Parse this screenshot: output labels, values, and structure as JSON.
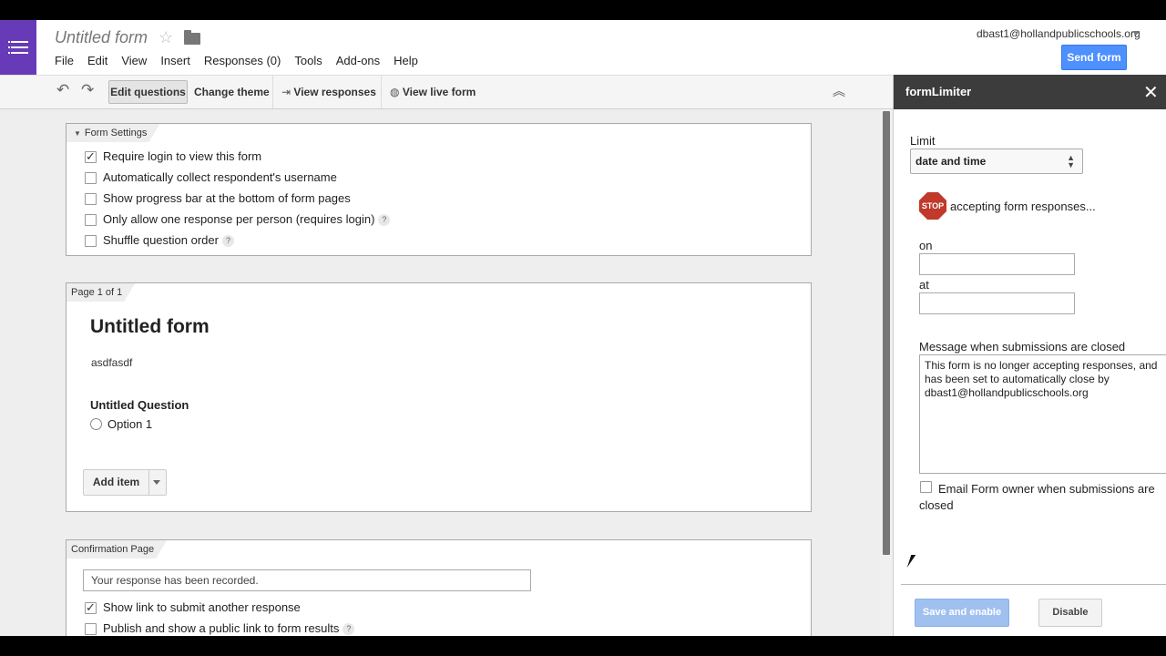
{
  "header": {
    "doc_title": "Untitled form",
    "menu": [
      "File",
      "Edit",
      "View",
      "Insert",
      "Responses (0)",
      "Tools",
      "Add-ons",
      "Help"
    ],
    "user_email": "dbast1@hollandpublicschools.org",
    "send_form_label": "Send form"
  },
  "toolbar": {
    "edit_questions": "Edit questions",
    "change_theme": "Change theme",
    "view_responses": "View responses",
    "view_live_form": "View live form"
  },
  "form_settings": {
    "tab": "Form Settings",
    "options": [
      {
        "label": "Require login to view this form",
        "checked": true,
        "help": false
      },
      {
        "label": "Automatically collect respondent's username",
        "checked": false,
        "help": false
      },
      {
        "label": "Show progress bar at the bottom of form pages",
        "checked": false,
        "help": false
      },
      {
        "label": "Only allow one response per person (requires login)",
        "checked": false,
        "help": true
      },
      {
        "label": "Shuffle question order",
        "checked": false,
        "help": true
      }
    ]
  },
  "page": {
    "tab": "Page 1 of 1",
    "title": "Untitled form",
    "description": "asdfasdf",
    "question_title": "Untitled Question",
    "option_1": "Option 1",
    "add_item": "Add item"
  },
  "confirmation": {
    "tab": "Confirmation Page",
    "message_value": "Your response has been recorded.",
    "options": [
      {
        "label": "Show link to submit another response",
        "checked": true,
        "help": false
      },
      {
        "label": "Publish and show a public link to form results",
        "checked": false,
        "help": true
      }
    ]
  },
  "sidebar": {
    "title": "formLimiter",
    "limit_label": "Limit",
    "limit_value": "date and time",
    "stop_text": "STOP",
    "stop_message": "accepting form responses...",
    "on_label": "on",
    "at_label": "at",
    "message_label": "Message when submissions are closed",
    "message_value": "This form is no longer accepting responses, and has been set to automatically close by dbast1@hollandpublicschools.org",
    "email_owner_label": "Email Form owner when submissions are closed",
    "save_enable": "Save and enable",
    "disable": "Disable"
  }
}
